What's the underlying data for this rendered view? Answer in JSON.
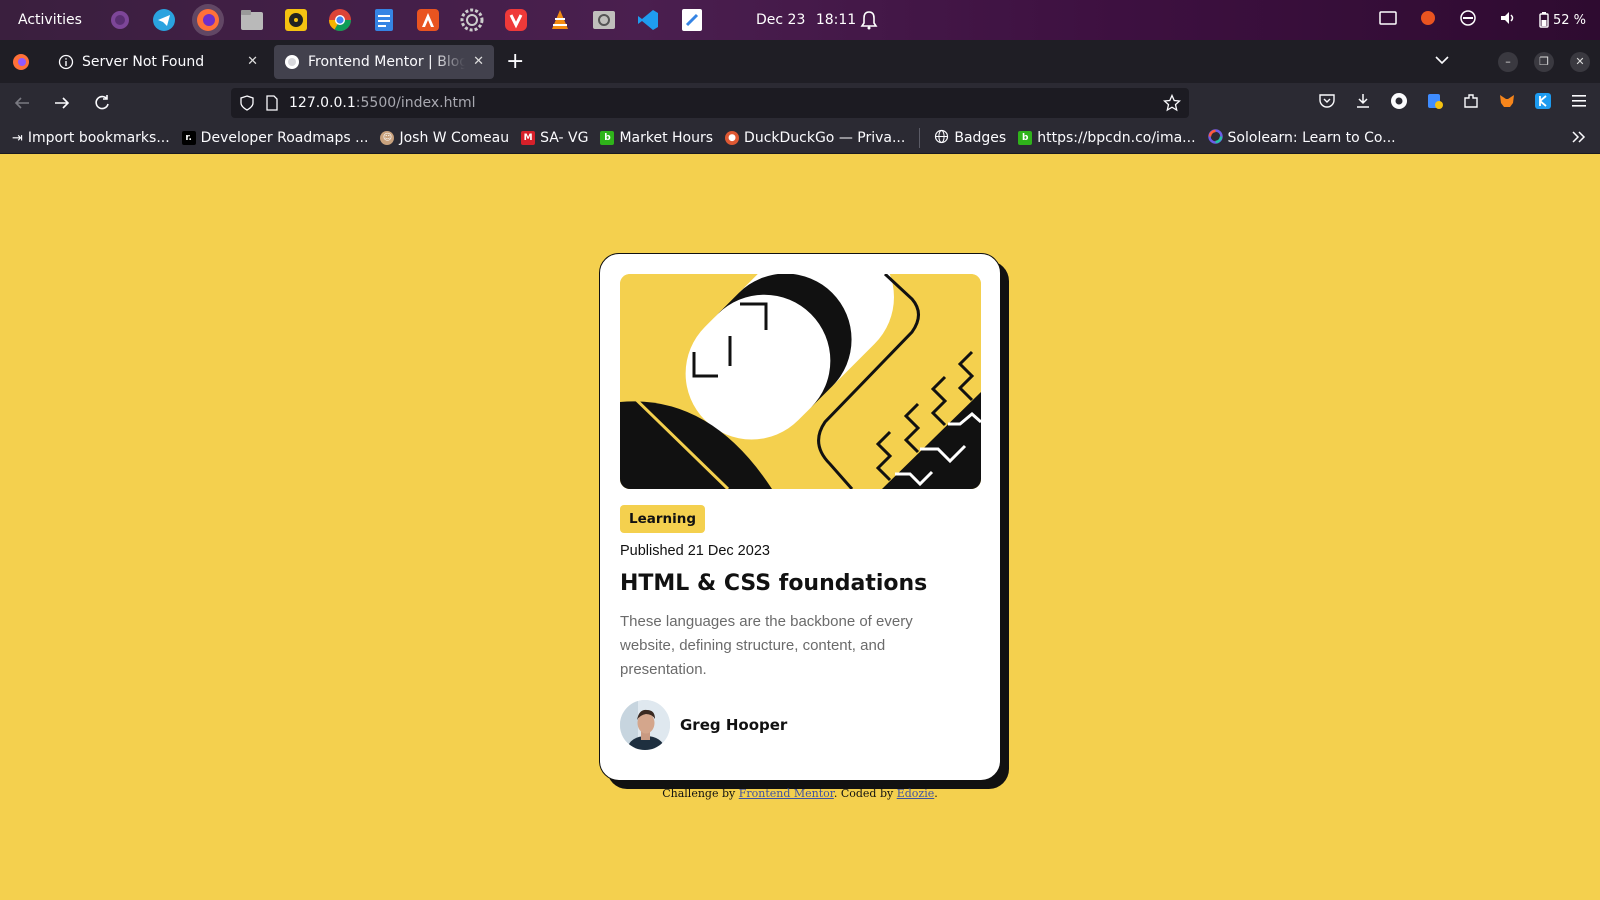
{
  "system_bar": {
    "activities": "Activities",
    "date": "Dec 23",
    "time": "18:11",
    "battery": "52 %",
    "dock_icons": [
      "tor-browser-icon",
      "telegram-icon",
      "firefox-icon",
      "files-icon",
      "rhythmbox-icon",
      "chrome-icon",
      "text-editor-icon",
      "app-center-icon",
      "settings-icon",
      "vivaldi-icon",
      "vlc-icon",
      "image-viewer-icon",
      "vscode-icon",
      "notes-icon"
    ]
  },
  "browser": {
    "tabs": [
      {
        "title": "Server Not Found",
        "active": false
      },
      {
        "title": "Frontend Mentor | Blog preview card",
        "active": true
      }
    ],
    "url_host": "127.0.0.1",
    "url_path": ":5500/index.html",
    "bookmarks": [
      {
        "label": "Import bookmarks...",
        "color": "#fbfbfe",
        "glyph": "⇥"
      },
      {
        "label": "Developer Roadmaps ...",
        "color": "#000000",
        "glyph": "r"
      },
      {
        "label": "Josh W Comeau",
        "color": "#c9a27e",
        "glyph": "☺"
      },
      {
        "label": "SA- VG",
        "color": "#d6202a",
        "glyph": "M"
      },
      {
        "label": "Market Hours",
        "color": "#2fb31a",
        "glyph": "b"
      },
      {
        "label": "DuckDuckGo — Priva...",
        "color": "#de5833",
        "glyph": "●"
      },
      {
        "label": "Badges",
        "color": "#2b2a33",
        "glyph": "⊕"
      },
      {
        "label": "https://bpcdn.co/ima...",
        "color": "#2fb31a",
        "glyph": "b"
      },
      {
        "label": "Sololearn: Learn to Co...",
        "color": "#6c5ce7",
        "glyph": "∞"
      }
    ]
  },
  "card": {
    "tag": "Learning",
    "published": "Published 21 Dec 2023",
    "title": "HTML & CSS foundations",
    "description": "These languages are the backbone of every website, defining structure, content, and presentation.",
    "author": "Greg Hooper"
  },
  "attribution": {
    "prefix": "Challenge by ",
    "link1": "Frontend Mentor",
    "middle": ". Coded by ",
    "link2": "Edozie",
    "suffix": "."
  },
  "colors": {
    "page_bg": "#f4d04e",
    "card_bg": "#ffffff",
    "ink": "#111111",
    "desc_gray": "#6b6b6b"
  }
}
